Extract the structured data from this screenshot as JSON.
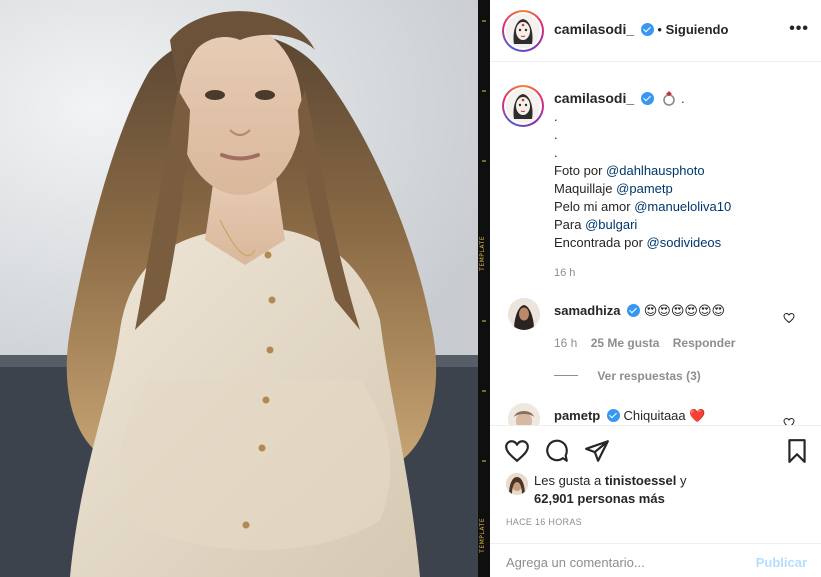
{
  "header": {
    "username": "camilasodi_",
    "separator": "•",
    "follow_status": "Siguiendo",
    "more_label": "•••"
  },
  "caption": {
    "username": "camilasodi_",
    "emoji_suffix": ".",
    "lines": [
      ".",
      ".",
      "."
    ],
    "credits": [
      {
        "label": "Foto por",
        "mention": "@dahlhausphoto"
      },
      {
        "label": "Maquillaje",
        "mention": "@pametp"
      },
      {
        "label": "Pelo mi amor",
        "mention": "@manueloliva10"
      },
      {
        "label": "Para",
        "mention": "@bulgari"
      },
      {
        "label": "Encontrada por",
        "mention": "@sodivideos"
      }
    ],
    "time": "16 h"
  },
  "comments": [
    {
      "username": "samadhiza",
      "text": "😍😍😍😍😍😍",
      "time": "16 h",
      "likes": "25 Me gusta",
      "reply_label": "Responder",
      "view_replies": "Ver respuestas (3)"
    },
    {
      "username": "pametp",
      "text": "Chiquitaaa ❤️"
    }
  ],
  "likes": {
    "prefix": "Les gusta a",
    "user": "tinistoessel",
    "conj": "y",
    "count": "62,901 personas más"
  },
  "post_time": "HACE 16 HORAS",
  "comment_input": {
    "placeholder": "Agrega un comentario...",
    "publish_label": "Publicar"
  },
  "film_strip": {
    "label": "TEMPLATE"
  },
  "colors": {
    "verified": "#3897f0",
    "mention": "#00376b",
    "publish_disabled": "#b2dffc",
    "heart": "#ed4956"
  }
}
